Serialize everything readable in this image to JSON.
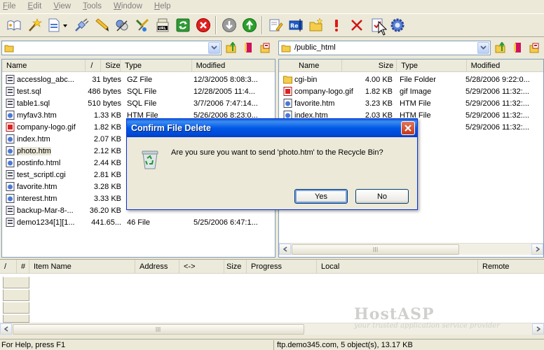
{
  "menu": [
    {
      "label": "File",
      "key": "F",
      "rest": "ile"
    },
    {
      "label": "Edit",
      "key": "E",
      "rest": "dit"
    },
    {
      "label": "View",
      "key": "V",
      "rest": "iew"
    },
    {
      "label": "Tools",
      "key": "T",
      "rest": "ools"
    },
    {
      "label": "Window",
      "key": "W",
      "rest": "indow"
    },
    {
      "label": "Help",
      "key": "H",
      "rest": "elp"
    }
  ],
  "toolbar": {
    "icons": [
      "connect-book-icon",
      "wizard-icon",
      "new-file-icon",
      "disconnect-plug-icon",
      "pencil-icon",
      "transfer-icon",
      "tools-icon",
      "url-icon",
      "refresh-icon",
      "stop-icon",
      "download-arrow-icon",
      "upload-arrow-icon",
      "edit-icon",
      "rename-icon",
      "new-folder-icon",
      "alert-icon",
      "delete-icon",
      "properties-icon",
      "settings-gear-icon"
    ]
  },
  "local": {
    "path": "",
    "columns": [
      "Name",
      "/",
      "Size",
      "Type",
      "Modified"
    ],
    "files": [
      {
        "name": "accesslog_abc...",
        "size": "31 bytes",
        "type": "GZ File",
        "modified": "12/3/2005 8:08:3..."
      },
      {
        "name": "test.sql",
        "size": "486 bytes",
        "type": "SQL File",
        "modified": "12/28/2005 11:4..."
      },
      {
        "name": "table1.sql",
        "size": "510 bytes",
        "type": "SQL File",
        "modified": "3/7/2006 7:47:14..."
      },
      {
        "name": "myfav3.htm",
        "size": "1.33 KB",
        "type": "HTM File",
        "modified": "5/26/2006 8:23:0..."
      },
      {
        "name": "company-logo.gif",
        "size": "1.82 KB",
        "type": "",
        "modified": ""
      },
      {
        "name": "index.htm",
        "size": "2.07 KB",
        "type": "",
        "modified": ""
      },
      {
        "name": "photo.htm",
        "size": "2.12 KB",
        "type": "",
        "modified": ""
      },
      {
        "name": "postinfo.html",
        "size": "2.44 KB",
        "type": "",
        "modified": ""
      },
      {
        "name": "test_scriptl.cgi",
        "size": "2.81 KB",
        "type": "",
        "modified": ""
      },
      {
        "name": "favorite.htm",
        "size": "3.28 KB",
        "type": "",
        "modified": ""
      },
      {
        "name": "interest.htm",
        "size": "3.33 KB",
        "type": "",
        "modified": ""
      },
      {
        "name": "backup-Mar-8-...",
        "size": "36.20 KB",
        "type": "",
        "modified": ""
      },
      {
        "name": "demo1234[1][1...",
        "size": "441.65...",
        "type": "46 File",
        "modified": "5/25/2006 6:47:1..."
      }
    ]
  },
  "remote": {
    "path": "/public_html",
    "columns": [
      "Name",
      "Size",
      "Type",
      "Modified"
    ],
    "files": [
      {
        "name": "cgi-bin",
        "size": "4.00 KB",
        "type": "File Folder",
        "modified": "5/28/2006 9:22:0..."
      },
      {
        "name": "company-logo.gif",
        "size": "1.82 KB",
        "type": "gif Image",
        "modified": "5/29/2006 11:32:..."
      },
      {
        "name": "favorite.htm",
        "size": "3.23 KB",
        "type": "HTM File",
        "modified": "5/29/2006 11:32:..."
      },
      {
        "name": "index.htm",
        "size": "2.03 KB",
        "type": "HTM File",
        "modified": "5/29/2006 11:32:..."
      },
      {
        "name": "",
        "size": "",
        "type": "",
        "modified": "5/29/2006 11:32:..."
      }
    ]
  },
  "queue": {
    "columns": [
      "/",
      "#",
      "Item Name",
      "Address",
      "<->",
      "Size",
      "Progress",
      "Local",
      "Remote"
    ]
  },
  "watermark": {
    "brand": "HostASP",
    "tagline": "your trusted application service provider"
  },
  "status": {
    "left": "For Help, press F1",
    "right": "ftp.demo345.com, 5 object(s), 13.17 KB"
  },
  "dialog": {
    "title": "Confirm File Delete",
    "message": "Are you sure you want to send 'photo.htm' to the Recycle Bin?",
    "yes": "Yes",
    "no": "No"
  }
}
